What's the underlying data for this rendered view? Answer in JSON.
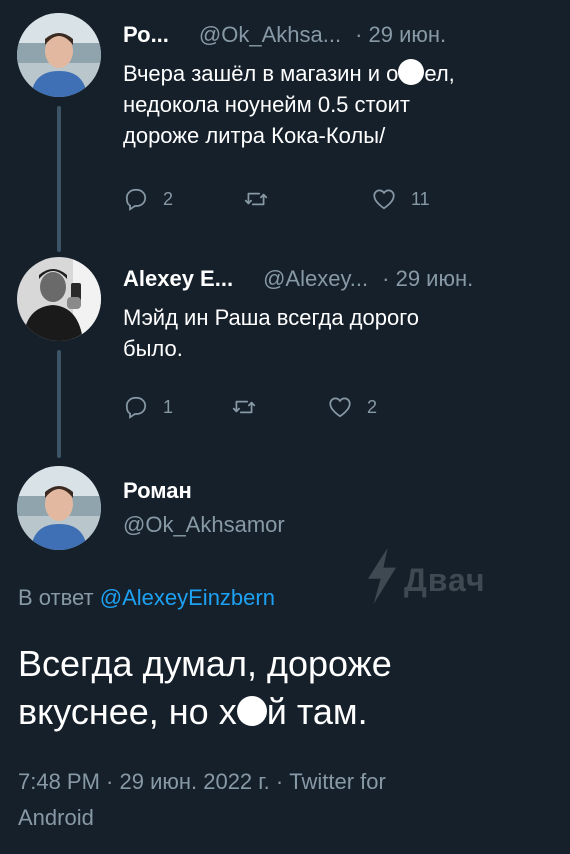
{
  "tweets": [
    {
      "name": "Ро...",
      "handle": "@Ok_Akhsa...",
      "date": "· 29 июн.",
      "text_lines": [
        "Вчера зашёл в магазин и о",
        "ел,",
        "недокола ноунейм 0.5 стоит",
        "дороже литра Кока-Колы/"
      ],
      "replies": "2",
      "retweets": "",
      "likes": "11"
    },
    {
      "name": "Alexey E...",
      "handle": "@Alexey...",
      "date": "· 29 июн.",
      "text_lines": [
        "Мэйд ин Раша всегда дорого",
        "было."
      ],
      "replies": "1",
      "retweets": "",
      "likes": "2"
    }
  ],
  "main_tweet": {
    "name": "Роман",
    "handle": "@Ok_Akhsamor",
    "reply_prefix": "В ответ",
    "reply_mention": "@AlexeyEinzbern",
    "text_line1": "Всегда думал, дороже",
    "text_line2_a": "вкуснее, но х",
    "text_line2_b": "й там.",
    "meta_line1": "7:48 PM · 29 июн. 2022 г. · Twitter for",
    "meta_line2": "Android"
  },
  "watermark": {
    "text": "Двач"
  },
  "icons": {
    "reply": "reply-icon",
    "retweet": "retweet-icon",
    "like": "heart-icon"
  },
  "colors": {
    "background": "#15202b",
    "muted": "#8899a6",
    "link": "#1da1f2",
    "thread_line": "#3d5466"
  }
}
